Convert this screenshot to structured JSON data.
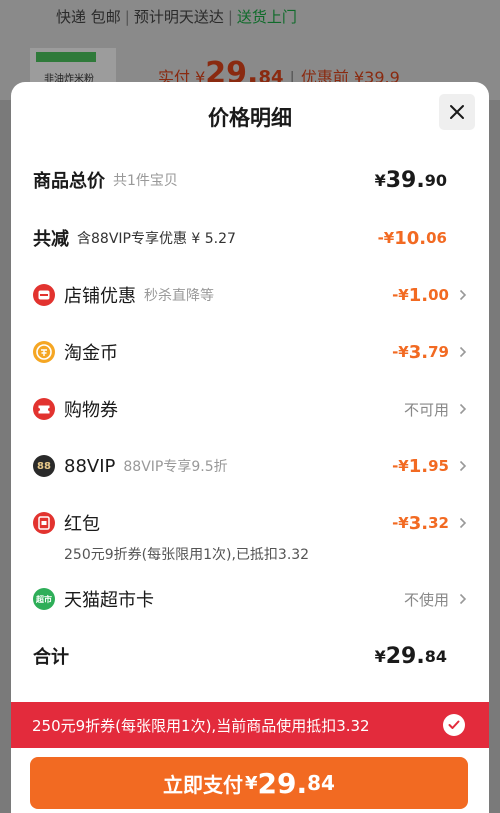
{
  "background": {
    "shipping": [
      "快递 包邮",
      "预计明天送达",
      "送货上门"
    ],
    "product_thumb_name": "非油炸米粉",
    "price_prefix": "实付",
    "price_yen": "¥",
    "price_int": "29.",
    "price_dec": "84",
    "price_before": "优惠前 ¥39.9"
  },
  "sheet": {
    "title": "价格明细",
    "close_icon": "close-icon"
  },
  "rows": {
    "total_goods": {
      "label": "商品总价",
      "sub": "共1件宝贝",
      "yen": "¥",
      "int": "39.",
      "dec": "90"
    },
    "total_reduce": {
      "label": "共减",
      "sub": "含88VIP专享优惠 ¥ 5.27",
      "yen": "-¥",
      "int": "10.",
      "dec": "06"
    },
    "store_discount": {
      "label": "店铺优惠",
      "sub": "秒杀直降等",
      "yen": "-¥",
      "int": "1.",
      "dec": "00",
      "icon": "store-coupon-icon"
    },
    "taojinbi": {
      "label": "淘金币",
      "yen": "-¥",
      "int": "3.",
      "dec": "79",
      "icon": "gold-coin-icon"
    },
    "shopping_coupon": {
      "label": "购物券",
      "status": "不可用",
      "icon": "coupon-ticket-icon"
    },
    "vip88": {
      "label": "88VIP",
      "sub": "88VIP专享9.5折",
      "yen": "-¥",
      "int": "1.",
      "dec": "95",
      "icon": "vip88-icon",
      "icon_text": "88"
    },
    "red_packet": {
      "label": "红包",
      "yen": "-¥",
      "int": "3.",
      "dec": "32",
      "icon": "red-packet-icon",
      "note": "250元9折券(每张限用1次),已抵扣3.32"
    },
    "tmall_card": {
      "label": "天猫超市卡",
      "status": "不使用",
      "icon": "tmall-supermarket-card-icon",
      "icon_text": "超市"
    },
    "sum": {
      "label": "合计",
      "yen": "¥",
      "int": "29.",
      "dec": "84"
    }
  },
  "banner": {
    "text": "250元9折券(每张限用1次),当前商品使用抵扣3.32",
    "icon": "check-icon"
  },
  "pay_button": {
    "label": "立即支付",
    "yen": "¥",
    "int": "29.",
    "dec": "84"
  },
  "colors": {
    "accent_orange": "#f26a22",
    "banner_red": "#e32b3c",
    "green": "#0f6b2a"
  }
}
